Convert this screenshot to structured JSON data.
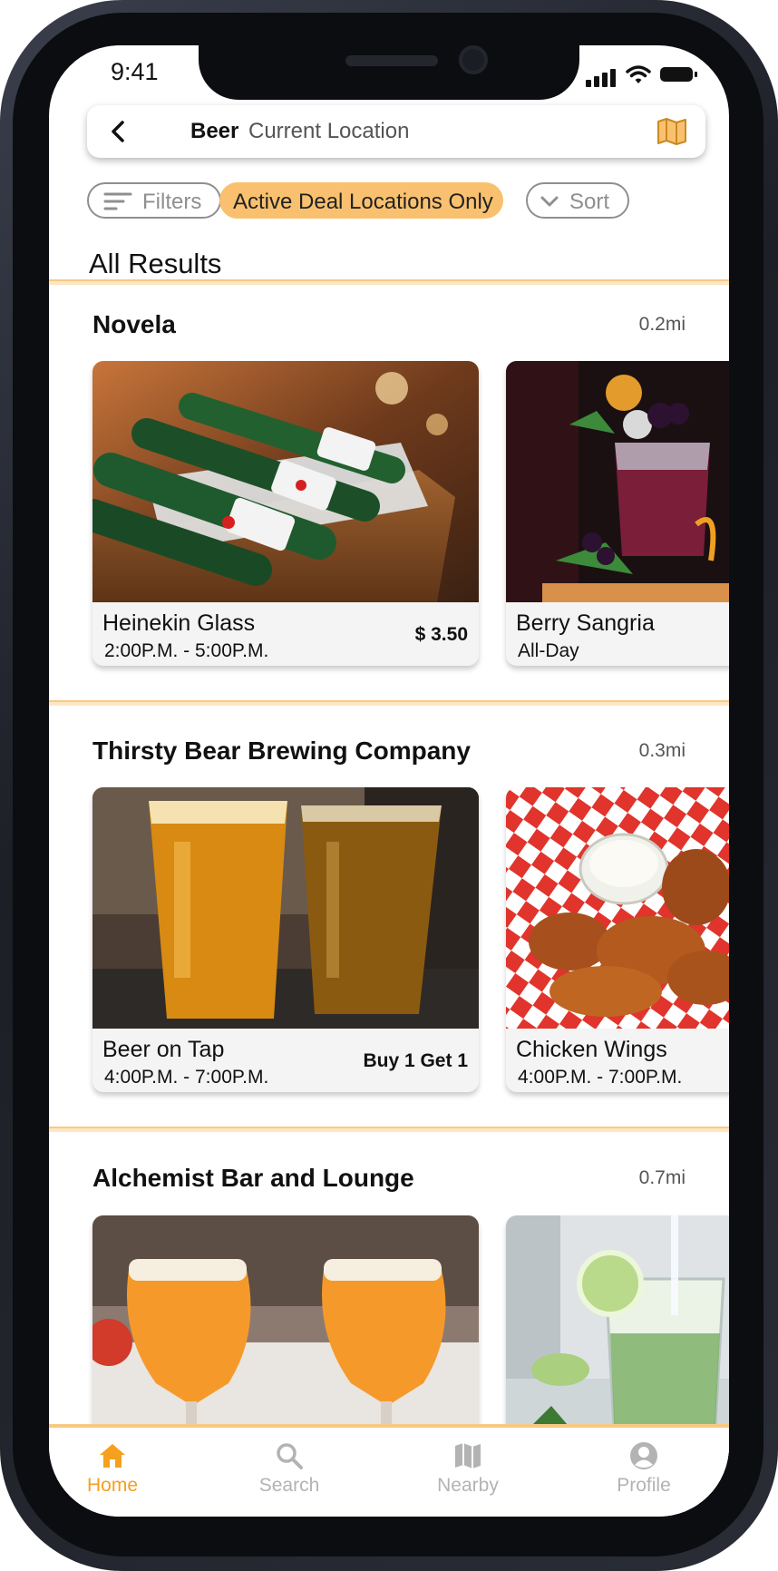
{
  "status_bar": {
    "time": "9:41"
  },
  "search": {
    "term": "Beer",
    "location": "Current Location"
  },
  "filters": {
    "filters_label": "Filters",
    "active_deal_label": "Active Deal Locations Only",
    "sort_label": "Sort"
  },
  "results": {
    "heading": "All Results",
    "venues": [
      {
        "name": "Novela",
        "distance": "0.2mi",
        "deals": [
          {
            "title": "Heinekin Glass",
            "time": "2:00P.M. - 5:00P.M.",
            "price": "$ 3.50"
          },
          {
            "title": "Berry Sangria",
            "time": "All-Day"
          }
        ]
      },
      {
        "name": "Thirsty Bear Brewing Company",
        "distance": "0.3mi",
        "deals": [
          {
            "title": "Beer on Tap",
            "time": "4:00P.M. - 7:00P.M.",
            "price": "Buy 1 Get 1"
          },
          {
            "title": "Chicken Wings",
            "time": "4:00P.M. - 7:00P.M."
          }
        ]
      },
      {
        "name": "Alchemist Bar and Lounge",
        "distance": "0.7mi",
        "deals": [
          {},
          {}
        ]
      }
    ]
  },
  "tab_bar": {
    "tabs": [
      {
        "label": "Home",
        "icon": "home-icon",
        "active": true
      },
      {
        "label": "Search",
        "icon": "search-icon",
        "active": false
      },
      {
        "label": "Nearby",
        "icon": "map-icon",
        "active": false
      },
      {
        "label": "Profile",
        "icon": "profile-icon",
        "active": false
      }
    ]
  },
  "colors": {
    "accent": "#f5a01e",
    "chip_active": "#f9c16f",
    "divider": "#f8c983",
    "muted": "#b3b3b3"
  }
}
